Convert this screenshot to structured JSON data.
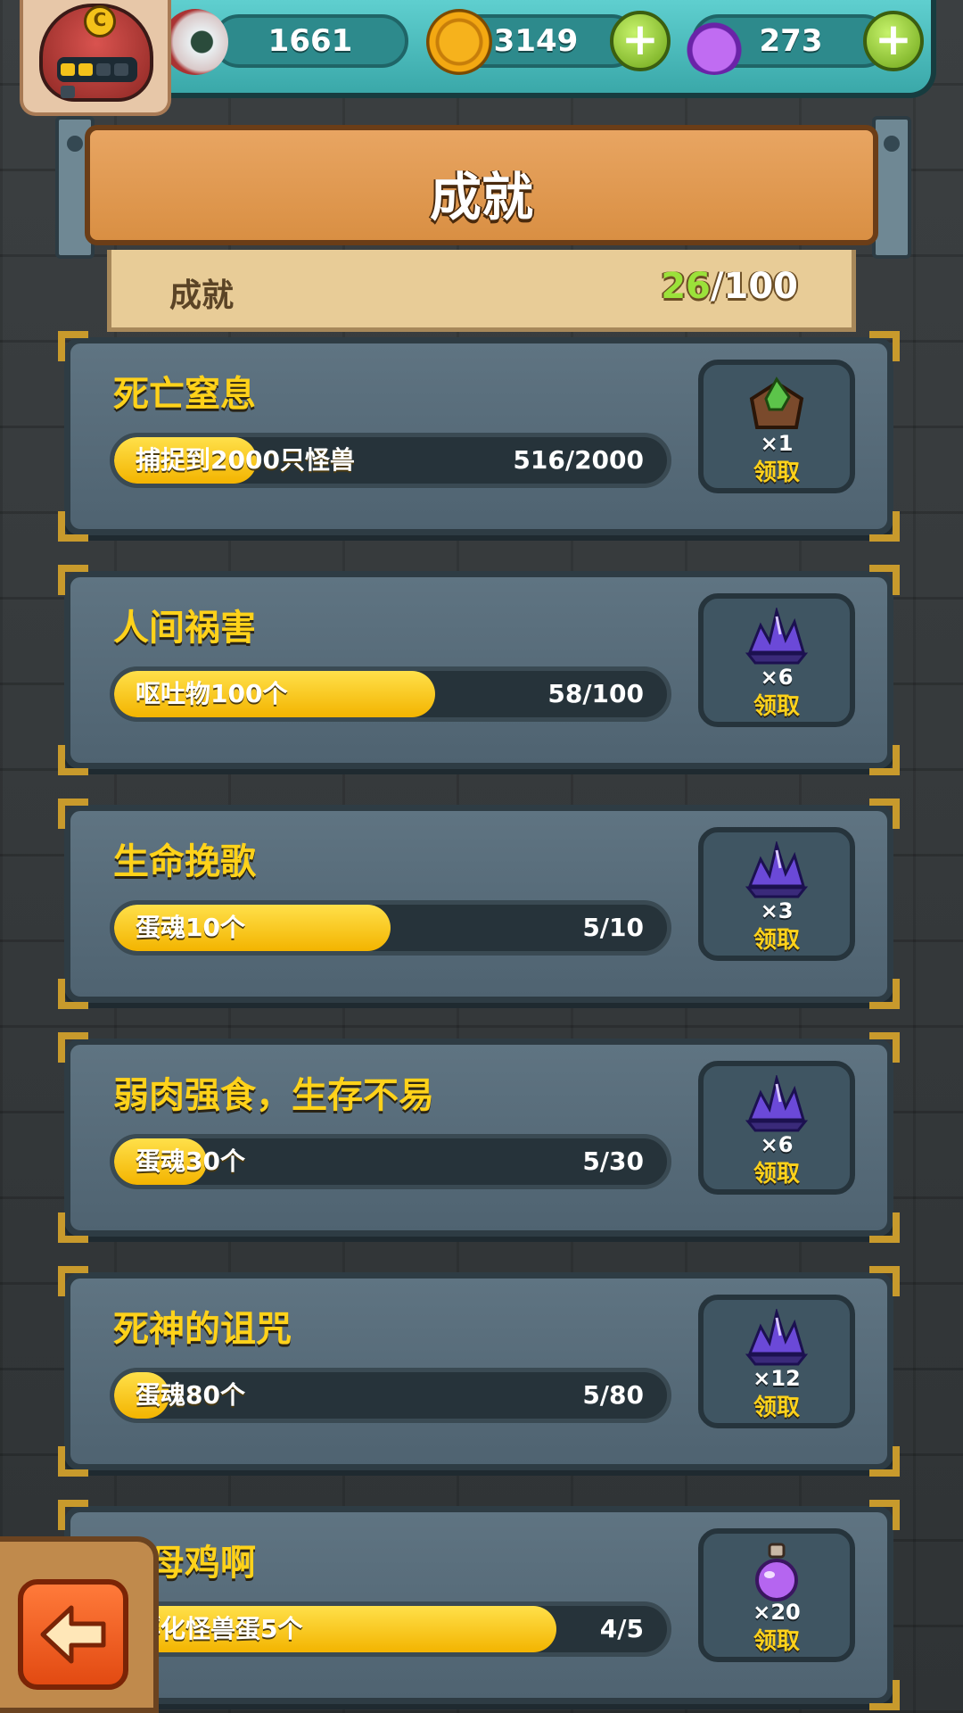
{
  "header": {
    "resources": [
      {
        "name": "eyeball",
        "icon": "eyeball-icon",
        "value": "1661"
      },
      {
        "name": "coin",
        "icon": "coin-icon",
        "value": "3149"
      },
      {
        "name": "potion",
        "icon": "potion-icon",
        "value": "273"
      }
    ],
    "avatar_badge": "C"
  },
  "title": "成就",
  "summary": {
    "label": "成就",
    "current": "26",
    "total": "/100"
  },
  "achievements": [
    {
      "name": "死亡窒息",
      "desc": "捕捉到2000只怪兽",
      "progress_text": "516/2000",
      "fraction": 0.258,
      "reward_icon": "green-crystal-icon",
      "reward_qty": "×1",
      "claim": "领取"
    },
    {
      "name": "人间祸害",
      "desc": "呕吐物100个",
      "progress_text": "58/100",
      "fraction": 0.58,
      "reward_icon": "purple-crystal-icon",
      "reward_qty": "×6",
      "claim": "领取"
    },
    {
      "name": "生命挽歌",
      "desc": "蛋魂10个",
      "progress_text": "5/10",
      "fraction": 0.5,
      "reward_icon": "purple-crystal-icon",
      "reward_qty": "×3",
      "claim": "领取"
    },
    {
      "name": "弱肉强食，生存不易",
      "desc": "蛋魂30个",
      "progress_text": "5/30",
      "fraction": 0.167,
      "reward_icon": "purple-crystal-icon",
      "reward_qty": "×6",
      "claim": "领取"
    },
    {
      "name": "死神的诅咒",
      "desc": "蛋魂80个",
      "progress_text": "5/80",
      "fraction": 0.0625,
      "reward_icon": "purple-crystal-icon",
      "reward_qty": "×12",
      "claim": "领取"
    },
    {
      "name": "是母鸡啊",
      "desc": "孵化怪兽蛋5个",
      "progress_text": "4/5",
      "fraction": 0.8,
      "reward_icon": "potion-icon",
      "reward_qty": "×20",
      "claim": "领取"
    }
  ],
  "colors": {
    "accent_yellow": "#ffd21a",
    "progress_green": "#9be23a",
    "teal_bar": "#3aa8a9"
  }
}
